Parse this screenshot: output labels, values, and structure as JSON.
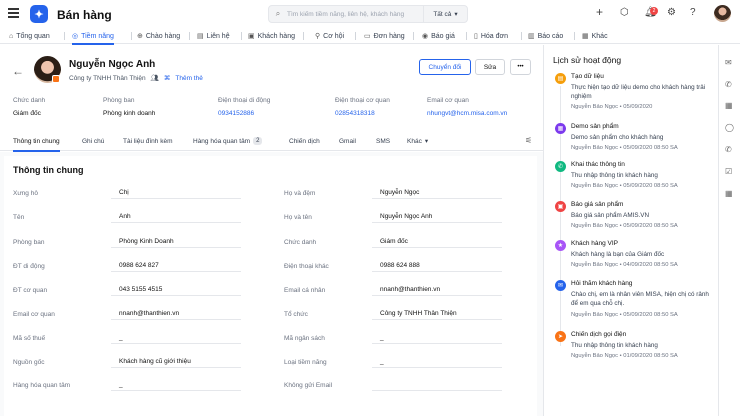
{
  "app": {
    "title": "Bán hàng",
    "logo": "chat-logo-icon"
  },
  "search": {
    "placeholder": "Tìm kiếm tiềm năng, liên hệ, khách hàng",
    "scope": "Tất cả"
  },
  "notifications": {
    "count": "2"
  },
  "nav": [
    {
      "label": "Tổng quan",
      "icon": "home-icon"
    },
    {
      "label": "Tiềm năng",
      "icon": "target-icon",
      "active": true
    },
    {
      "label": "Chào hàng",
      "icon": "gift-icon"
    },
    {
      "label": "Liên hệ",
      "icon": "contact-icon"
    },
    {
      "label": "Khách hàng",
      "icon": "customer-icon"
    },
    {
      "label": "Cơ hội",
      "icon": "opportunity-icon"
    },
    {
      "label": "Đơn hàng",
      "icon": "order-icon"
    },
    {
      "label": "Báo giá",
      "icon": "quote-icon"
    },
    {
      "label": "Hóa đơn",
      "icon": "invoice-icon"
    },
    {
      "label": "Báo cáo",
      "icon": "report-icon"
    },
    {
      "label": "Khác",
      "icon": "more-icon"
    }
  ],
  "profile": {
    "name": "Nguyễn Ngọc Anh",
    "company": "Công ty TNHH Thân Thiện",
    "add_tag": "Thêm thẻ",
    "convert_label": "Chuyển đổi",
    "edit_label": "Sửa",
    "more_label": "•••"
  },
  "summary": [
    {
      "label": "Chức danh",
      "value": "Giám đốc",
      "link": false
    },
    {
      "label": "Phòng ban",
      "value": "Phòng kinh doanh",
      "link": false
    },
    {
      "label": "Điện thoại di động",
      "value": "0934152886",
      "link": true
    },
    {
      "label": "Điện thoại cơ quan",
      "value": "02854318318",
      "link": true
    },
    {
      "label": "Email cơ quan",
      "value": "nhungvt@hcm.misa.com.vn",
      "link": true
    }
  ],
  "subtabs": [
    {
      "label": "Thông tin chung",
      "active": true
    },
    {
      "label": "Ghi chú"
    },
    {
      "label": "Tài liệu đính kèm"
    },
    {
      "label": "Hàng hóa quan tâm",
      "count": "2"
    },
    {
      "label": "Chiến dịch"
    },
    {
      "label": "Gmail"
    },
    {
      "label": "SMS"
    },
    {
      "label": "Khác"
    }
  ],
  "section_title": "Thông tin chung",
  "fields_left": [
    {
      "label": "Xưng hô",
      "value": "Chị"
    },
    {
      "label": "Tên",
      "value": "Anh"
    },
    {
      "label": "Phòng ban",
      "value": "Phòng Kinh Doanh"
    },
    {
      "label": "ĐT di động",
      "value": "0988 624 827"
    },
    {
      "label": "ĐT cơ quan",
      "value": "043 5155 4515"
    },
    {
      "label": "Email cơ quan",
      "value": "nnanh@thanthien.vn"
    },
    {
      "label": "Mã số thuế",
      "value": "_"
    },
    {
      "label": "Nguồn gốc",
      "value": "Khách hàng cũ giới thiệu"
    },
    {
      "label": "Hàng hóa quan tâm",
      "value": "_"
    }
  ],
  "fields_right": [
    {
      "label": "Họ và đệm",
      "value": "Nguyễn Ngọc"
    },
    {
      "label": "Họ và tên",
      "value": "Nguyễn Ngọc Anh"
    },
    {
      "label": "Chức danh",
      "value": "Giám đốc"
    },
    {
      "label": "Điện thoại khác",
      "value": "0988 624 888"
    },
    {
      "label": "Email cá nhân",
      "value": "nnanh@thanthien.vn"
    },
    {
      "label": "Tổ chức",
      "value": "Công ty TNHH Thân Thiện"
    },
    {
      "label": "Mã ngân sách",
      "value": "_"
    },
    {
      "label": "Loại tiềm năng",
      "value": "_"
    },
    {
      "label": "Không gửi Email",
      "value": ""
    }
  ],
  "activity_title": "Lịch sử hoạt động",
  "activities": [
    {
      "title": "Tạo dữ liệu",
      "desc": "Thực hiện tạo dữ liệu demo cho khách hàng trải nghiệm",
      "meta": "Nguyễn Bảo Ngọc • 05/09/2020",
      "color": "#f59e0b",
      "icon": "document-icon"
    },
    {
      "title": "Demo sản phẩm",
      "desc": "Demo sản phẩm cho khách hàng",
      "meta": "Nguyễn Bảo Ngọc • 05/09/2020 08:50 SA",
      "color": "#7c3aed",
      "icon": "calendar-icon"
    },
    {
      "title": "Khai thác thông tin",
      "desc": "Thu nhập thông tin khách hàng",
      "meta": "Nguyễn Bảo Ngọc • 05/09/2020 08:50 SA",
      "color": "#10b981",
      "icon": "phone-icon"
    },
    {
      "title": "Báo giá sản phẩm",
      "desc": "Báo giá sản phẩm AMIS.VN",
      "meta": "Nguyễn Bảo Ngọc • 05/09/2020 08:50 SA",
      "color": "#ef4444",
      "icon": "quote-icon"
    },
    {
      "title": "Khách hàng VIP",
      "desc": "Khách hàng là bạn của Giám đốc",
      "meta": "Nguyễn Bảo Ngọc • 04/09/2020 08:50 SA",
      "color": "#a855f7",
      "icon": "vip-icon"
    },
    {
      "title": "Hỏi thăm khách hàng",
      "desc": "Chào chị, em là nhân viên MISA, hiện chị có rảnh để em qua chỗ chị.",
      "meta": "Nguyễn Bảo Ngọc • 05/09/2020 08:50 SA",
      "color": "#2563eb",
      "icon": "email-icon"
    },
    {
      "title": "Chiến dịch gọi điện",
      "desc": "Thu nhập thông tin khách hàng",
      "meta": "Nguyễn Bảo Ngọc • 01/09/2020 08:50 SA",
      "color": "#f97316",
      "icon": "campaign-icon"
    }
  ],
  "rail_icons": [
    "email-icon",
    "phone-icon",
    "calendar-icon",
    "chat-icon",
    "call-icon",
    "task-icon",
    "calendar-icon"
  ]
}
